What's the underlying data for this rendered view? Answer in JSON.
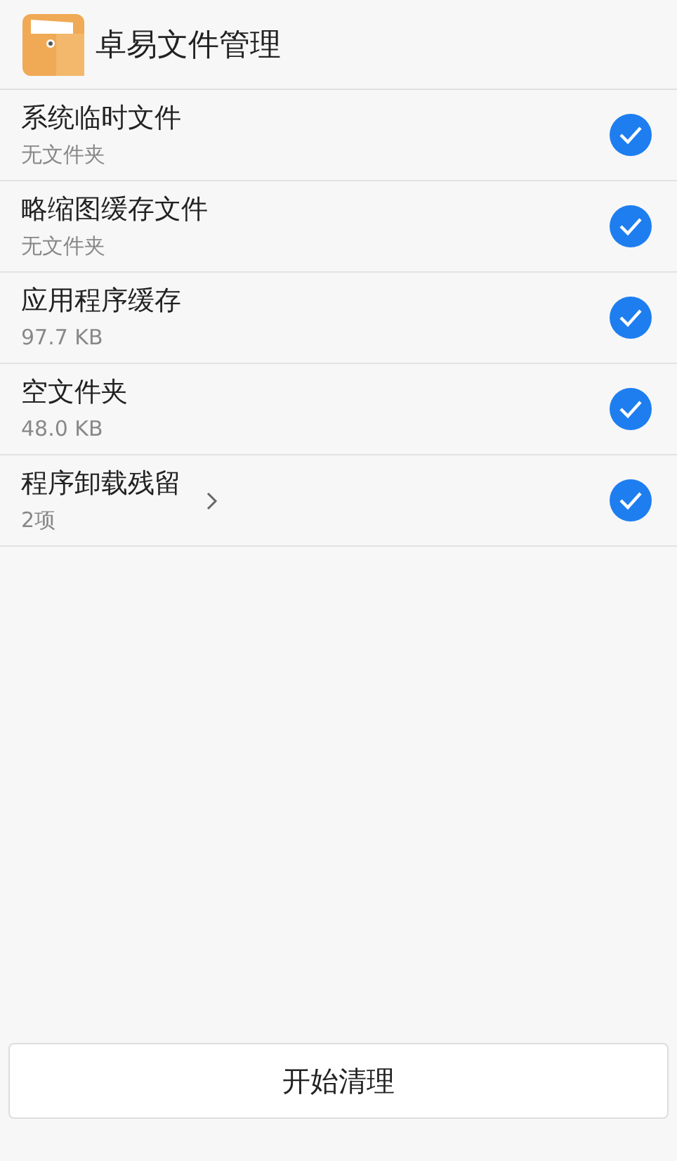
{
  "header": {
    "title": "卓易文件管理"
  },
  "items": [
    {
      "name": "系统临时文件",
      "detail": "无文件夹",
      "expandable": false,
      "checked": true
    },
    {
      "name": "略缩图缓存文件",
      "detail": "无文件夹",
      "expandable": false,
      "checked": true
    },
    {
      "name": "应用程序缓存",
      "detail": "97.7 KB",
      "expandable": false,
      "checked": true
    },
    {
      "name": "空文件夹",
      "detail": "48.0 KB",
      "expandable": false,
      "checked": true
    },
    {
      "name": "程序卸载残留",
      "detail": "2项",
      "expandable": true,
      "checked": true
    }
  ],
  "button": {
    "label": "开始清理"
  }
}
